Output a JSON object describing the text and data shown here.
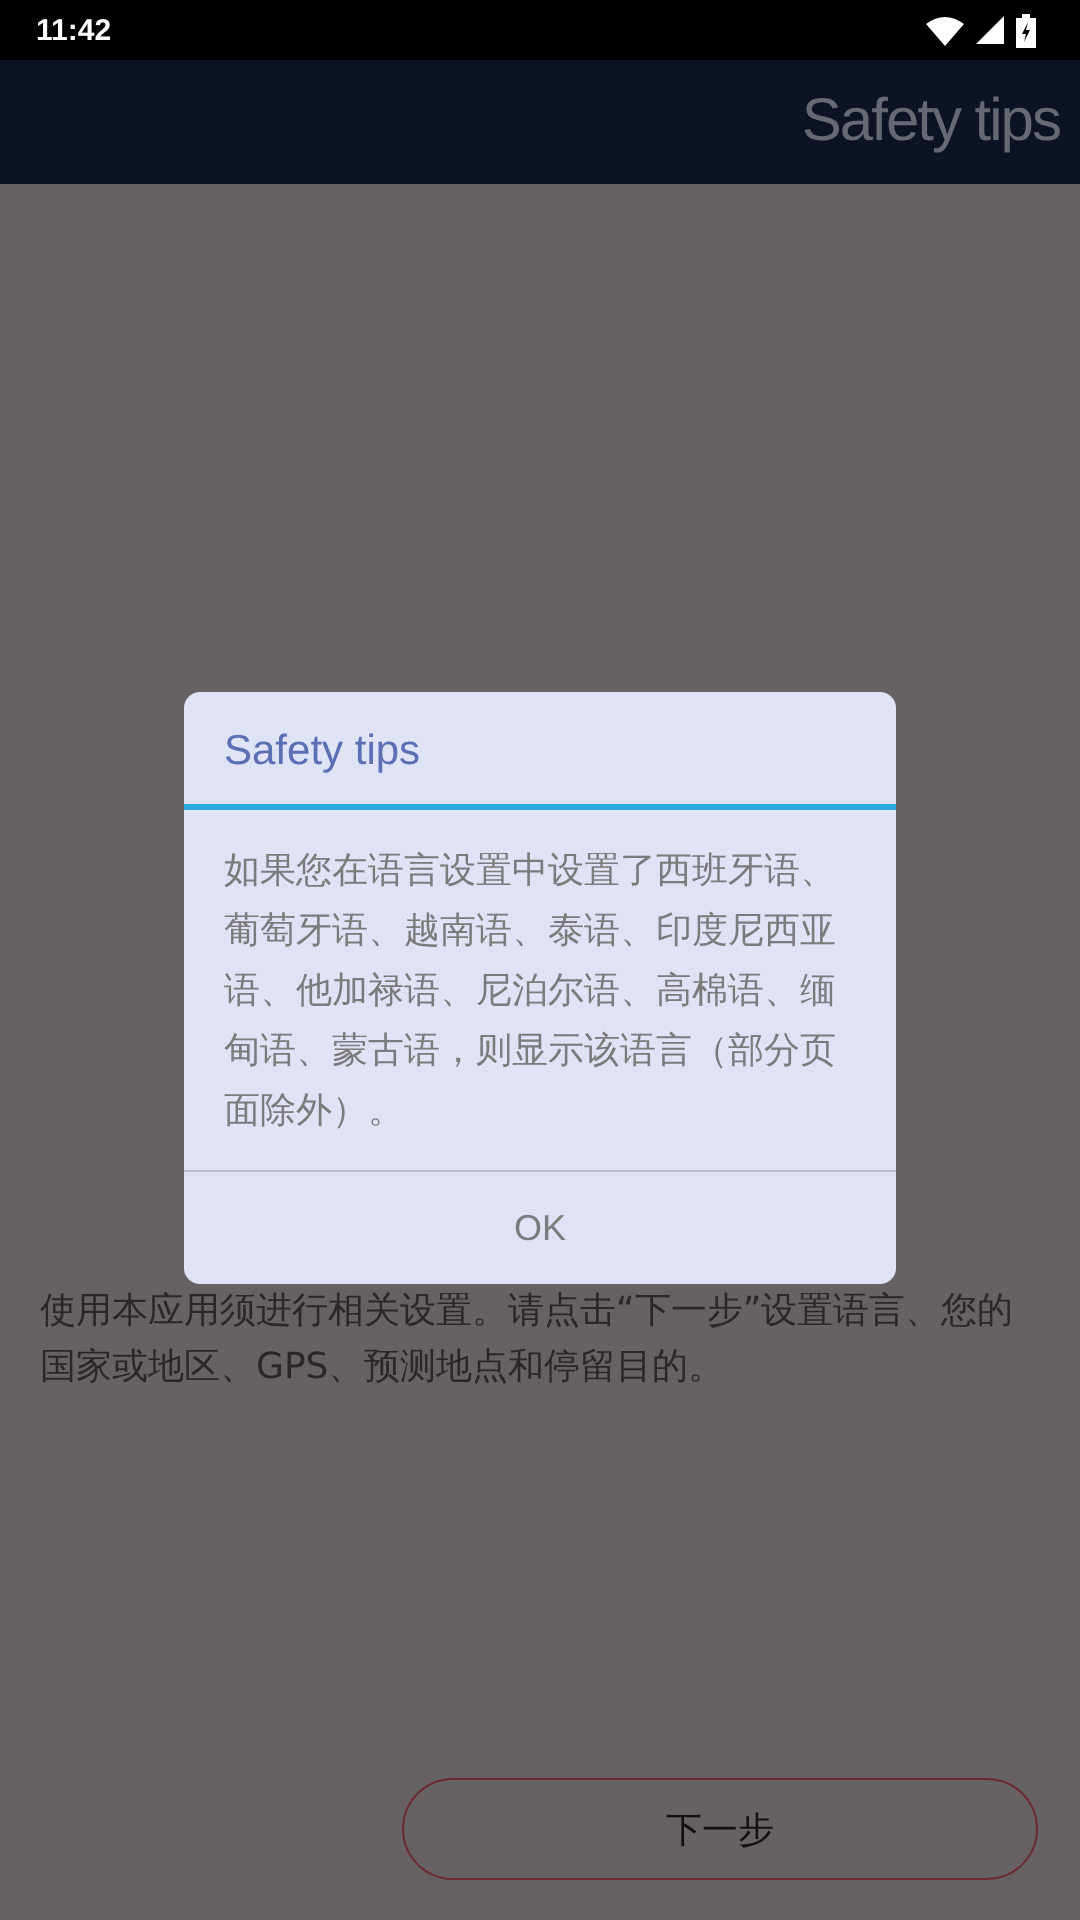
{
  "status_bar": {
    "time": "11:42"
  },
  "header": {
    "title": "Safety tips"
  },
  "intro": {
    "text": "使用本应用须进行相关设置。请点击“下一步”设置语言、您的国家或地区、GPS、预测地点和停留目的。"
  },
  "next_button": {
    "label": "下一步"
  },
  "dialog": {
    "title": "Safety tips",
    "message": "如果您在语言设置中设置了西班牙语、葡萄牙语、越南语、泰语、印度尼西亚语、他加禄语、尼泊尔语、高棉语、缅甸语、蒙古语，则显示该语言（部分页面除外）。",
    "buttons": [
      "OK"
    ]
  }
}
